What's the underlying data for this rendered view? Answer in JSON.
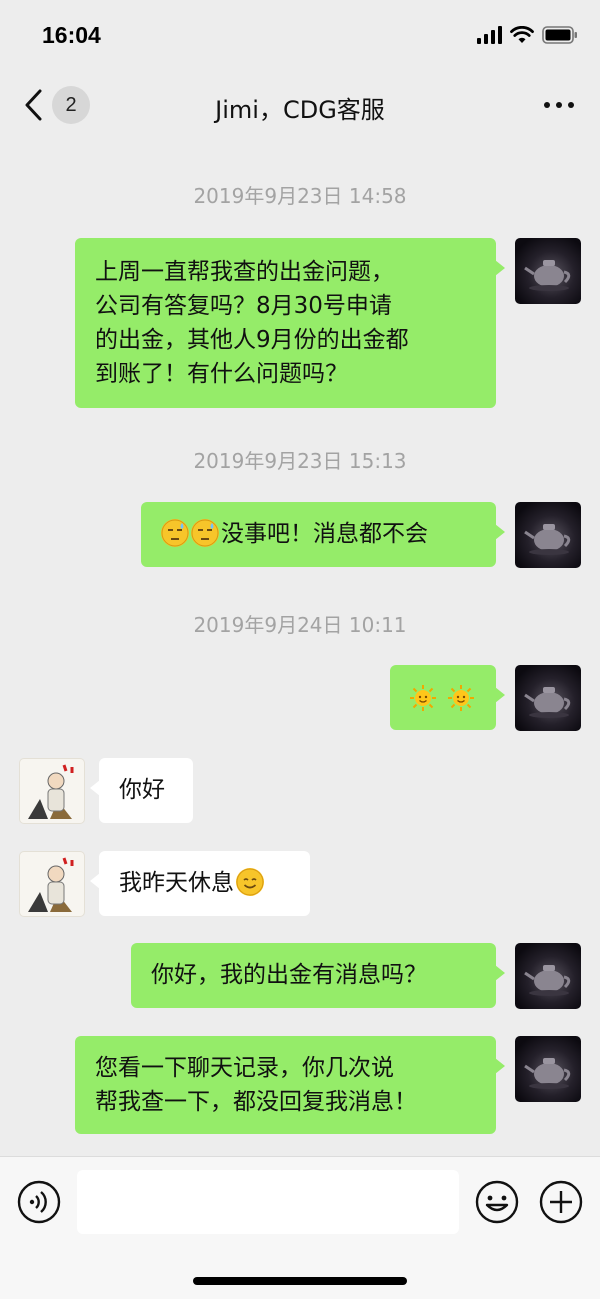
{
  "status_bar": {
    "time": "16:04"
  },
  "nav": {
    "unread_count": "2",
    "title": "Jimi，CDG客服"
  },
  "chat": {
    "timestamps": [
      "2019年9月23日 14:58",
      "2019年9月23日 15:13",
      "2019年9月24日 10:11"
    ],
    "messages": [
      {
        "sender": "me",
        "lines": [
          "上周一直帮我查的出金问题，",
          "公司有答复吗？8月30号申请",
          "的出金，其他人9月份的出金都",
          "到账了！有什么问题吗？"
        ]
      },
      {
        "sender": "me",
        "emojis": [
          "sweat-face-emoji",
          "sweat-face-emoji"
        ],
        "text": "没事吧！消息都不会"
      },
      {
        "sender": "me",
        "emojis": [
          "sun-emoji",
          "sun-emoji"
        ]
      },
      {
        "sender": "other",
        "text": "你好"
      },
      {
        "sender": "other",
        "text": "我昨天休息",
        "emoji": "smile-emoji"
      },
      {
        "sender": "me",
        "text": "你好，我的出金有消息吗？"
      },
      {
        "sender": "me",
        "lines": [
          "您看一下聊天记录，你几次说",
          "帮我查一下，都没回复我消息！"
        ]
      }
    ]
  },
  "input_bar": {
    "placeholder": ""
  },
  "colors": {
    "outgoing_bubble": "#95ec69",
    "incoming_bubble": "#ffffff",
    "background": "#ededed"
  }
}
